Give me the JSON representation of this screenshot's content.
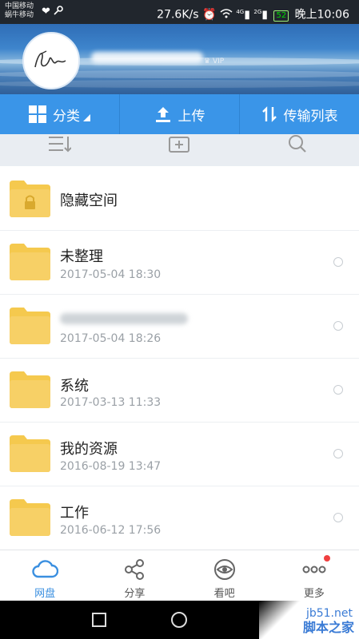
{
  "status_bar": {
    "carrier_line1": "中国移动",
    "carrier_line2": "蜗牛移动",
    "speed": "27.6K/s",
    "network_4g": "4G",
    "network_2g": "2G",
    "battery": "52",
    "time": "晚上10:06"
  },
  "header": {
    "vip_label": "VIP"
  },
  "toolbar": {
    "category_label": "分类",
    "upload_label": "上传",
    "transfer_label": "传输列表"
  },
  "files": [
    {
      "name": "隐藏空间",
      "date": "",
      "locked": true,
      "name_hidden": false
    },
    {
      "name": "未整理",
      "date": "2017-05-04  18:30",
      "locked": false,
      "name_hidden": false
    },
    {
      "name": "",
      "date": "2017-05-04  18:26",
      "locked": false,
      "name_hidden": true
    },
    {
      "name": "系统",
      "date": "2017-03-13  11:33",
      "locked": false,
      "name_hidden": false
    },
    {
      "name": "我的资源",
      "date": "2016-08-19  13:47",
      "locked": false,
      "name_hidden": false
    },
    {
      "name": "工作",
      "date": "2016-06-12  17:56",
      "locked": false,
      "name_hidden": false
    }
  ],
  "bottom_nav": [
    {
      "label": "网盘",
      "icon": "cloud-icon",
      "active": true
    },
    {
      "label": "分享",
      "icon": "share-icon",
      "active": false
    },
    {
      "label": "看吧",
      "icon": "eye-icon",
      "active": false
    },
    {
      "label": "更多",
      "icon": "more-icon",
      "active": false,
      "badge": true
    }
  ],
  "watermark": {
    "line1": "jb51.net",
    "line2": "脚本之家"
  },
  "colors": {
    "accent": "#3a95e8",
    "folder": "#f5c94e",
    "active_nav": "#3a8fe0"
  }
}
